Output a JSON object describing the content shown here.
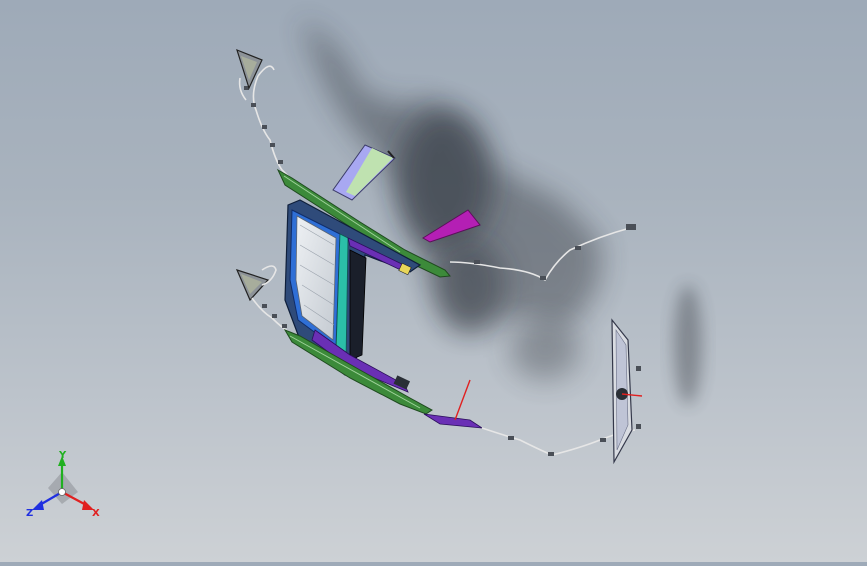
{
  "triad": {
    "x_label": "X",
    "y_label": "Y",
    "z_label": "Z",
    "x_color": "#e02020",
    "y_color": "#20b020",
    "z_color": "#2030e0"
  },
  "colors": {
    "background_top": "#9eaab8",
    "background_bottom": "#cdd1d5",
    "frame_blue": "#2f6fd6",
    "frame_green": "#3c8a3a",
    "frame_purple": "#6a2fb5",
    "panel_magenta": "#b41fb4",
    "panel_lavender": "#9aa0f0",
    "panel_pale_green": "#b8e0a8",
    "glass": "#d8dde2",
    "wire": "#e6e6e6",
    "shadow": "#2a2f36"
  }
}
